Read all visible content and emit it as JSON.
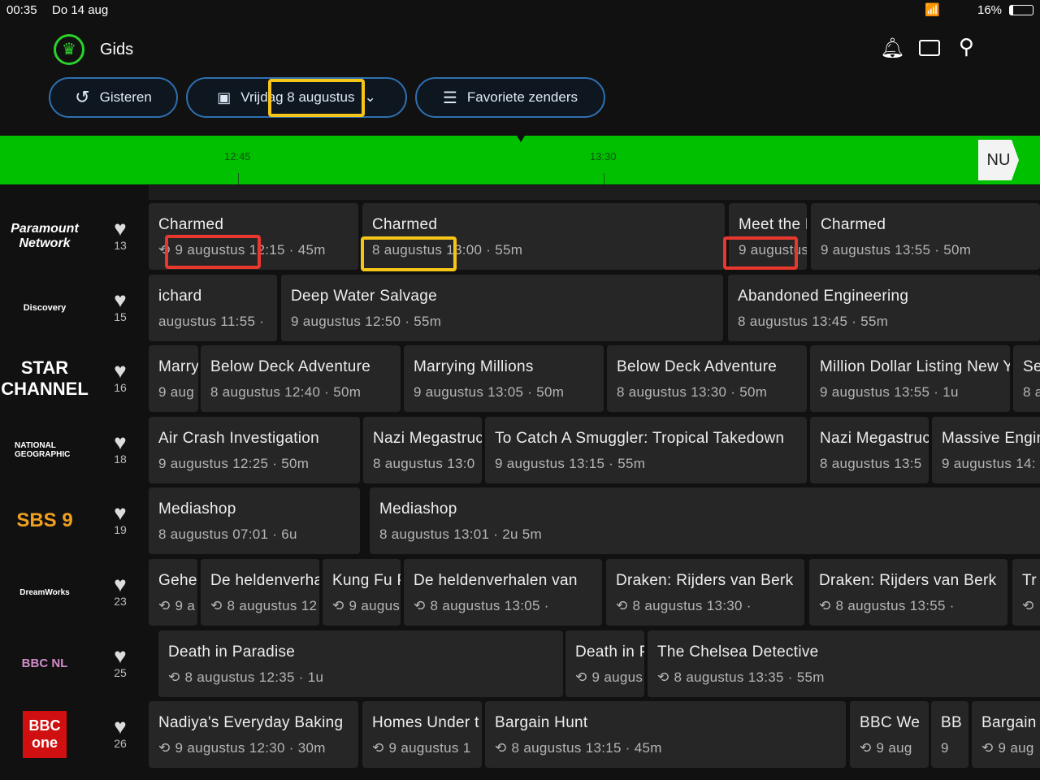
{
  "status": {
    "time": "00:35",
    "date": "Do 14 aug",
    "battery": "16%"
  },
  "header": {
    "title": "Gids"
  },
  "toolbar": {
    "yesterday": "Gisteren",
    "date_prefix": "Vrijdag",
    "date_value": "8 augustus",
    "favorites": "Favoriete zenders"
  },
  "timeline": {
    "ticks": [
      "12:45",
      "13:30"
    ],
    "now": "NU"
  },
  "colors": {
    "accent": "#00c000",
    "highlight_red": "#e8382e",
    "highlight_yellow": "#f5c518"
  },
  "channels": [
    {
      "logo": "Paramount Network",
      "number": "13",
      "programs": [
        {
          "title": "Charmed",
          "meta": "9 augustus 12:15 · 45m",
          "replay": true
        },
        {
          "title": "Charmed",
          "meta": "8 augustus 13:00 · 55m"
        },
        {
          "title": "Meet the Press",
          "meta": "9 augustus"
        },
        {
          "title": "Charmed",
          "meta": "9 augustus 13:55 · 50m"
        }
      ]
    },
    {
      "logo": "Discovery",
      "number": "15",
      "programs": [
        {
          "title": "ichard",
          "meta": "augustus 11:55 ·"
        },
        {
          "title": "Deep Water Salvage",
          "meta": "9 augustus 12:50 · 55m"
        },
        {
          "title": "Abandoned Engineering",
          "meta": "8 augustus 13:45 · 55m"
        }
      ]
    },
    {
      "logo": "STAR CHANNEL",
      "number": "16",
      "programs": [
        {
          "title": "Marry",
          "meta": "9 aug"
        },
        {
          "title": "Below Deck Adventure",
          "meta": "8 augustus 12:40 · 50m"
        },
        {
          "title": "Marrying Millions",
          "meta": "9 augustus 13:05 · 50m"
        },
        {
          "title": "Below Deck Adventure",
          "meta": "8 augustus 13:30 · 50m"
        },
        {
          "title": "Million Dollar Listing New Y",
          "meta": "9 augustus 13:55 · 1u"
        },
        {
          "title": "Se",
          "meta": "8 a"
        }
      ]
    },
    {
      "logo": "NATIONAL GEOGRAPHIC",
      "number": "18",
      "programs": [
        {
          "title": "Air Crash Investigation",
          "meta": "9 augustus 12:25 · 50m"
        },
        {
          "title": "Nazi Megastructures",
          "meta": "8 augustus 13:0"
        },
        {
          "title": "To Catch A Smuggler: Tropical Takedown",
          "meta": "9 augustus 13:15 · 55m"
        },
        {
          "title": "Nazi Megastruc",
          "meta": "8 augustus 13:5"
        },
        {
          "title": "Massive Engin",
          "meta": "9 augustus 14:"
        }
      ]
    },
    {
      "logo": "SBS 9",
      "number": "19",
      "programs": [
        {
          "title": "Mediashop",
          "meta": "8 augustus 07:01 · 6u"
        },
        {
          "title": "Mediashop",
          "meta": "8 augustus 13:01 · 2u 5m"
        }
      ]
    },
    {
      "logo": "DreamWorks",
      "number": "23",
      "programs": [
        {
          "title": "Gehei",
          "meta": "9 a",
          "replay": true
        },
        {
          "title": "De heldenverhalen",
          "meta": "8 augustus 12",
          "replay": true
        },
        {
          "title": "Kung Fu P",
          "meta": "9 augus",
          "replay": true
        },
        {
          "title": "De heldenverhalen van",
          "meta": "8 augustus 13:05 ·",
          "replay": true
        },
        {
          "title": "Draken: Rijders van Berk",
          "meta": "8 augustus 13:30 ·",
          "replay": true
        },
        {
          "title": "Draken: Rijders van Berk",
          "meta": "8 augustus 13:55 ·",
          "replay": true
        },
        {
          "title": "Tr",
          "meta": "",
          "replay": true
        }
      ]
    },
    {
      "logo": "BBC NL",
      "number": "25",
      "programs": [
        {
          "title": "Death in Paradise",
          "meta": "8 augustus 12:35 · 1u",
          "replay": true
        },
        {
          "title": "Death in P",
          "meta": "9 augus",
          "replay": true
        },
        {
          "title": "The Chelsea Detective",
          "meta": "8 augustus 13:35 · 55m",
          "replay": true
        }
      ]
    },
    {
      "logo": "BBC one",
      "number": "26",
      "programs": [
        {
          "title": "Nadiya's Everyday Baking",
          "meta": "9 augustus 12:30 · 30m",
          "replay": true
        },
        {
          "title": "Homes Under t",
          "meta": "9 augustus 1",
          "replay": true
        },
        {
          "title": "Bargain Hunt",
          "meta": "8 augustus 13:15 · 45m",
          "replay": true
        },
        {
          "title": "BBC We",
          "meta": "9 aug",
          "replay": true
        },
        {
          "title": "BB",
          "meta": "9"
        },
        {
          "title": "Bargain",
          "meta": "9 aug",
          "replay": true
        }
      ]
    }
  ]
}
